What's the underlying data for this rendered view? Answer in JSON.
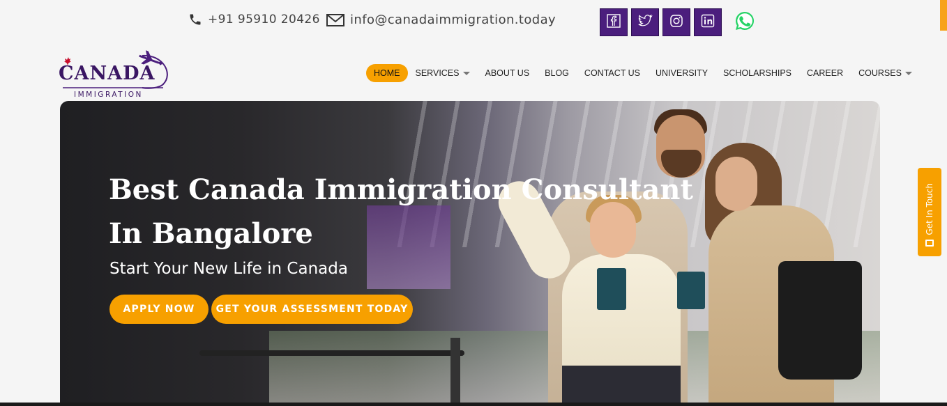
{
  "contact": {
    "phone": "+91 95910 20426",
    "email": "info@canadaimmigration.today"
  },
  "social": [
    {
      "name": "facebook-icon"
    },
    {
      "name": "twitter-icon"
    },
    {
      "name": "instagram-icon"
    },
    {
      "name": "linkedin-icon"
    },
    {
      "name": "whatsapp-icon"
    }
  ],
  "logo": {
    "word": "CANADA",
    "sub": "IMMIGRATION"
  },
  "nav": {
    "home": "HOME",
    "services": "SERVICES",
    "about": "ABOUT US",
    "blog": "BLOG",
    "contact": "CONTACT US",
    "university": "UNIVERSITY",
    "scholarships": "SCHOLARSHIPS",
    "career": "CAREER",
    "courses": "COURSES"
  },
  "hero": {
    "title_line1": "Best Canada Immigration Consultant",
    "title_line2": "In Bangalore",
    "tagline": "Start Your New Life in Canada",
    "apply_label": "APPLY NOW",
    "assessment_label": "GET YOUR ASSESSMENT TODAY"
  },
  "side_tab": {
    "label": "Get In Touch"
  },
  "colors": {
    "accent": "#f7a000",
    "brand_purple": "#4b1e7d"
  }
}
